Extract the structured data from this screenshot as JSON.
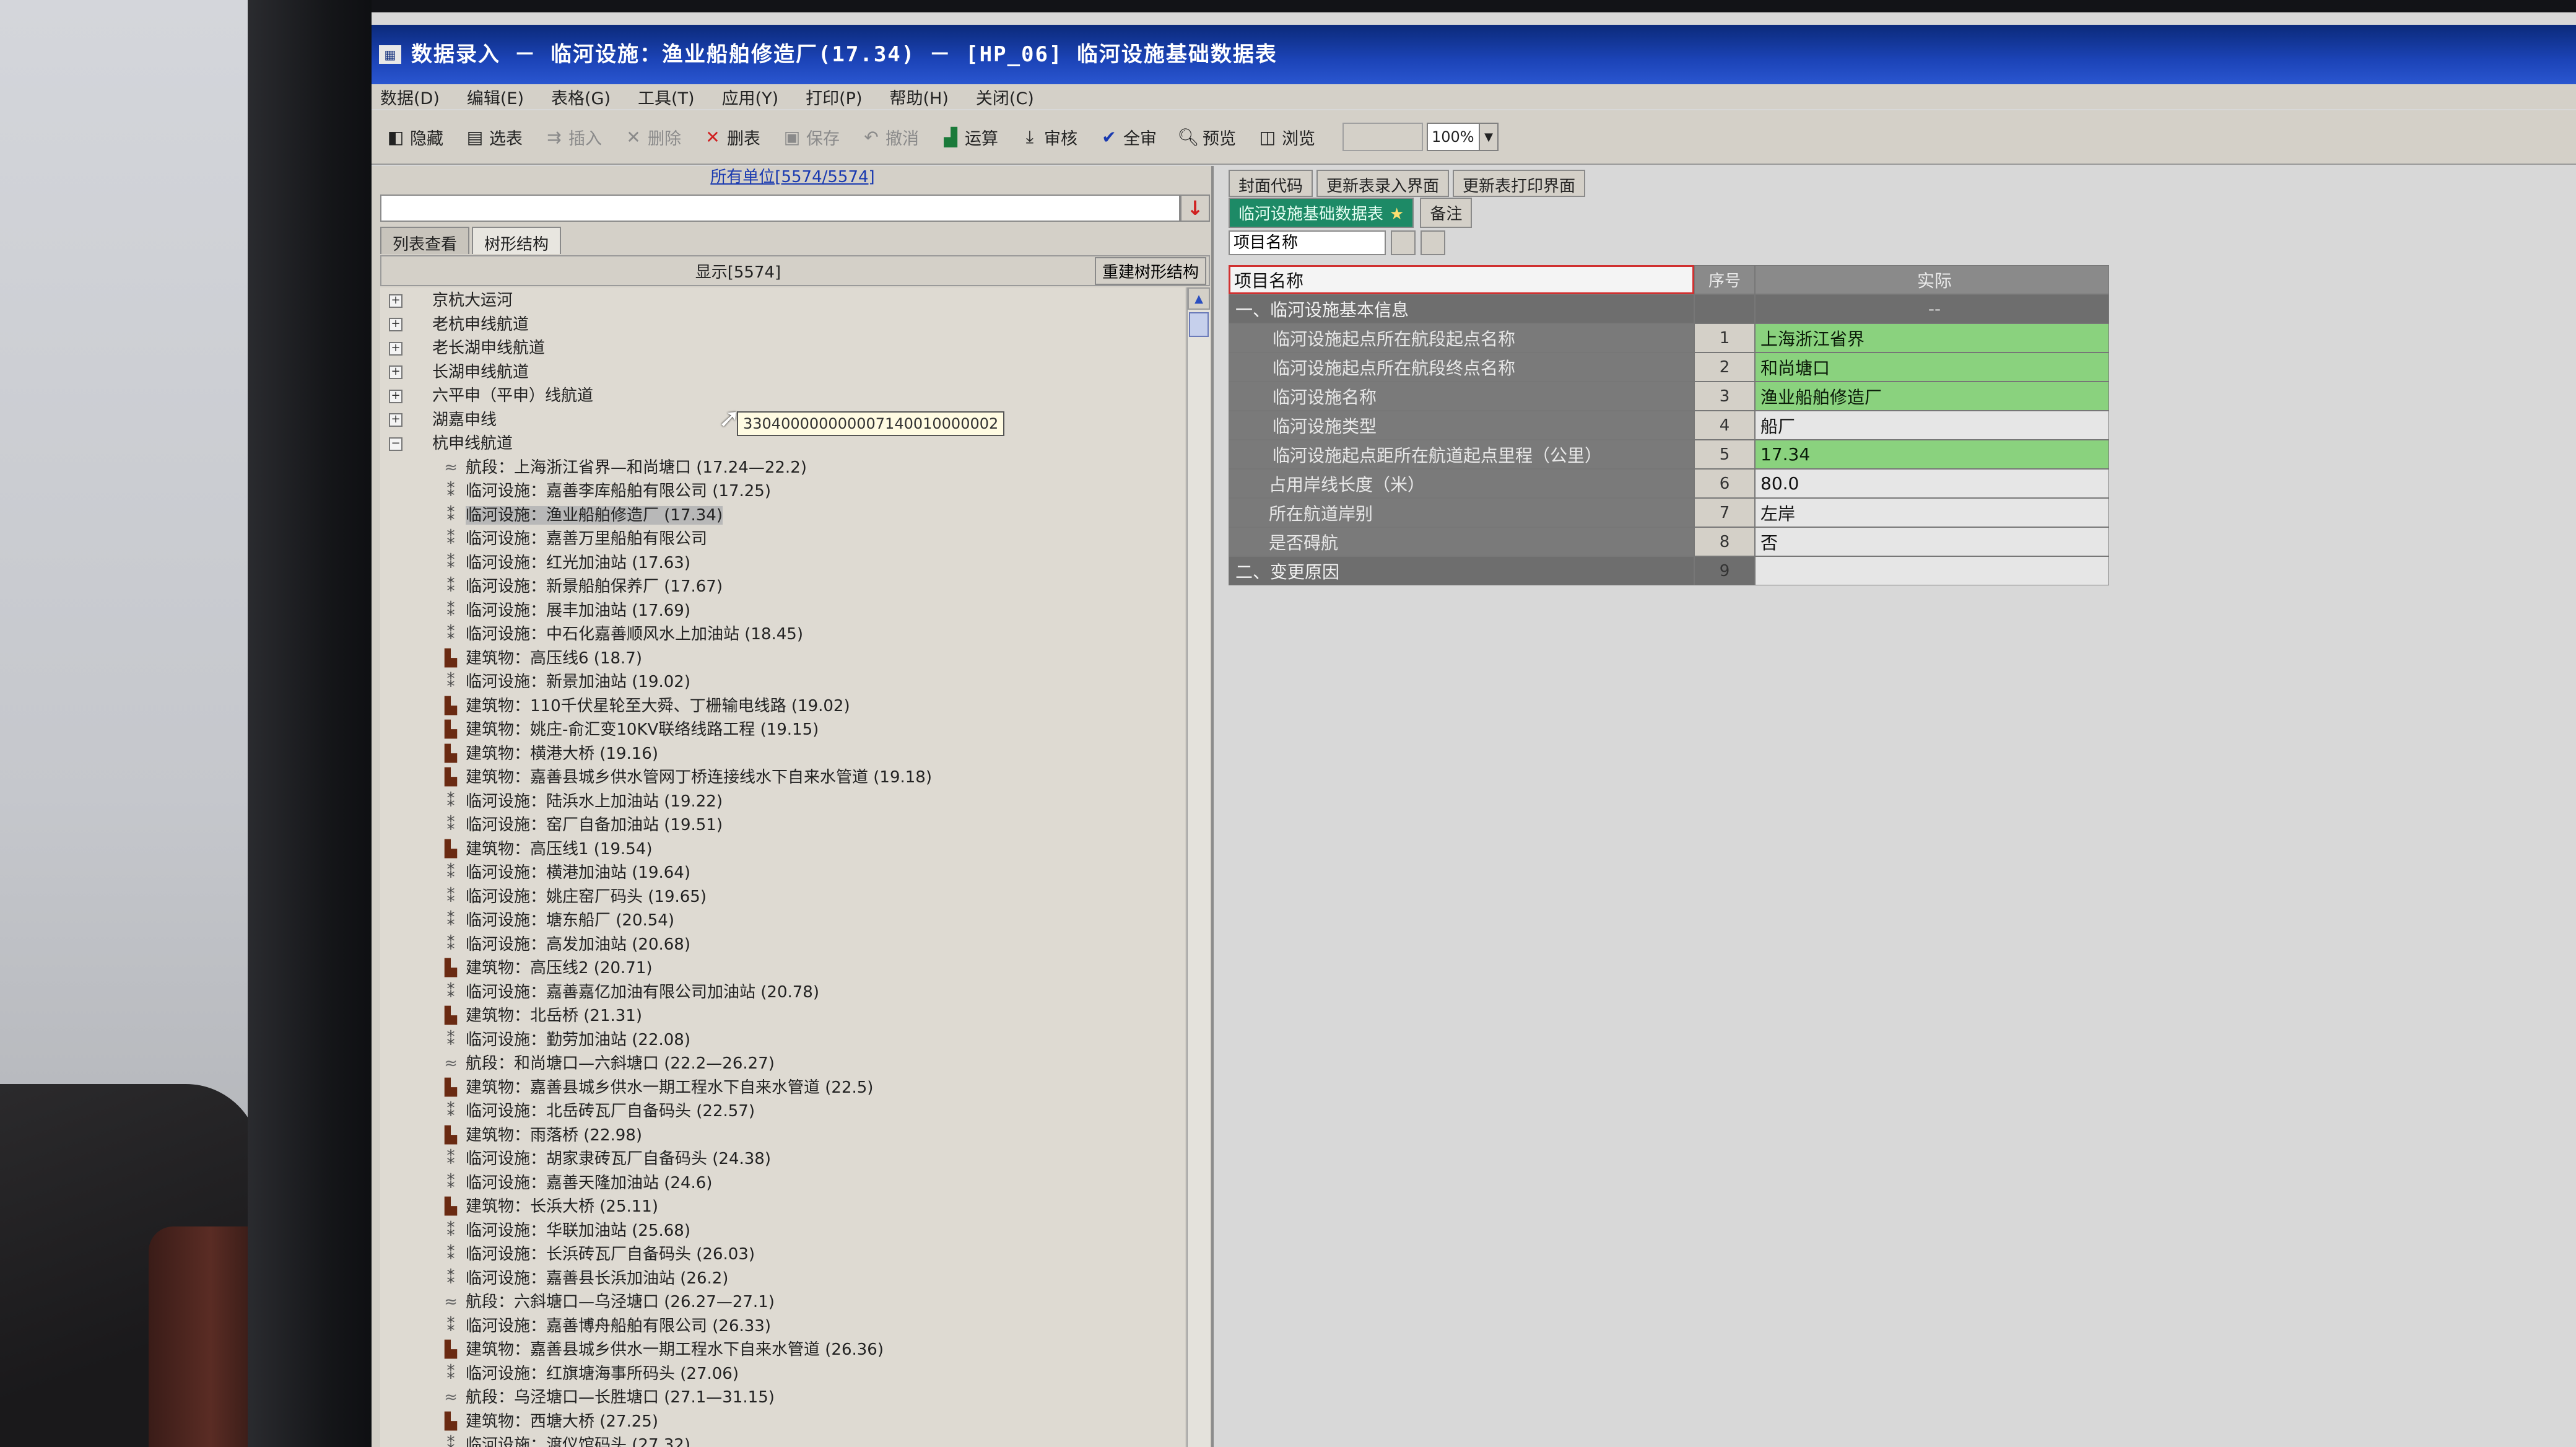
{
  "window": {
    "title": "数据录入 － 临河设施：渔业船舶修造厂(17.34) － [HP_06] 临河设施基础数据表"
  },
  "menu": [
    "数据(D)",
    "编辑(E)",
    "表格(G)",
    "工具(T)",
    "应用(Y)",
    "打印(P)",
    "帮助(H)",
    "关闭(C)"
  ],
  "toolbar": {
    "hide": "隐藏",
    "select_table": "选表",
    "insert": "插入",
    "delete": "删除",
    "delete_table": "删表",
    "save": "保存",
    "undo": "撤消",
    "calculate": "运算",
    "review": "审核",
    "full_review": "全审",
    "preview": "预览",
    "browse": "浏览",
    "zoom": "100%"
  },
  "left_panel": {
    "unit_link": "所有单位[5574/5574]",
    "search_value": "",
    "tabs": [
      "列表查看",
      "树形结构"
    ],
    "display_count": "显示[5574]",
    "rebuild_button": "重建树形结构",
    "tooltip": "330400000000007140010000002"
  },
  "tree": [
    {
      "label": "京杭大运河",
      "kind": "root",
      "exp": "⊞"
    },
    {
      "label": "老杭申线航道",
      "kind": "root",
      "exp": "⊞"
    },
    {
      "label": "老长湖申线航道",
      "kind": "root",
      "exp": "⊞"
    },
    {
      "label": "长湖申线航道",
      "kind": "root",
      "exp": "⊞"
    },
    {
      "label": "六平申（平申）线航道",
      "kind": "root",
      "exp": "⊞"
    },
    {
      "label": "湖嘉申线",
      "kind": "root",
      "exp": "⊞"
    },
    {
      "label": "杭申线航道",
      "kind": "root",
      "exp": "⊟"
    },
    {
      "label": "航段：上海浙江省界—和尚塘口 (17.24—22.2)",
      "kind": "seg"
    },
    {
      "label": "临河设施：嘉善李库船舶有限公司 (17.25)",
      "kind": "fac"
    },
    {
      "label": "临河设施：渔业船舶修造厂 (17.34)",
      "kind": "fac",
      "selected": true
    },
    {
      "label": "临河设施：嘉善万里船舶有限公司",
      "kind": "fac"
    },
    {
      "label": "临河设施：红光加油站 (17.63)",
      "kind": "fac"
    },
    {
      "label": "临河设施：新景船舶保养厂 (17.67)",
      "kind": "fac"
    },
    {
      "label": "临河设施：展丰加油站 (17.69)",
      "kind": "fac"
    },
    {
      "label": "临河设施：中石化嘉善顺风水上加油站 (18.45)",
      "kind": "fac"
    },
    {
      "label": "建筑物：高压线6 (18.7)",
      "kind": "bld"
    },
    {
      "label": "临河设施：新景加油站 (19.02)",
      "kind": "fac"
    },
    {
      "label": "建筑物：110千伏星轮至大舜、丁栅输电线路 (19.02)",
      "kind": "bld"
    },
    {
      "label": "建筑物：姚庄-俞汇变10KV联络线路工程 (19.15)",
      "kind": "bld"
    },
    {
      "label": "建筑物：横港大桥 (19.16)",
      "kind": "bld"
    },
    {
      "label": "建筑物：嘉善县城乡供水管网丁桥连接线水下自来水管道 (19.18)",
      "kind": "bld"
    },
    {
      "label": "临河设施：陆浜水上加油站 (19.22)",
      "kind": "fac"
    },
    {
      "label": "临河设施：窑厂自备加油站 (19.51)",
      "kind": "fac"
    },
    {
      "label": "建筑物：高压线1 (19.54)",
      "kind": "bld"
    },
    {
      "label": "临河设施：横港加油站 (19.64)",
      "kind": "fac"
    },
    {
      "label": "临河设施：姚庄窑厂码头 (19.65)",
      "kind": "fac"
    },
    {
      "label": "临河设施：塘东船厂 (20.54)",
      "kind": "fac"
    },
    {
      "label": "临河设施：高发加油站 (20.68)",
      "kind": "fac"
    },
    {
      "label": "建筑物：高压线2 (20.71)",
      "kind": "bld"
    },
    {
      "label": "临河设施：嘉善嘉亿加油有限公司加油站 (20.78)",
      "kind": "fac"
    },
    {
      "label": "建筑物：北岳桥 (21.31)",
      "kind": "bld"
    },
    {
      "label": "临河设施：勤劳加油站 (22.08)",
      "kind": "fac"
    },
    {
      "label": "航段：和尚塘口—六斜塘口 (22.2—26.27)",
      "kind": "seg"
    },
    {
      "label": "建筑物：嘉善县城乡供水一期工程水下自来水管道 (22.5)",
      "kind": "bld"
    },
    {
      "label": "临河设施：北岳砖瓦厂自备码头 (22.57)",
      "kind": "fac"
    },
    {
      "label": "建筑物：雨落桥 (22.98)",
      "kind": "bld"
    },
    {
      "label": "临河设施：胡家隶砖瓦厂自备码头 (24.38)",
      "kind": "fac"
    },
    {
      "label": "临河设施：嘉善天隆加油站 (24.6)",
      "kind": "fac"
    },
    {
      "label": "建筑物：长浜大桥 (25.11)",
      "kind": "bld"
    },
    {
      "label": "临河设施：华联加油站 (25.68)",
      "kind": "fac"
    },
    {
      "label": "临河设施：长浜砖瓦厂自备码头 (26.03)",
      "kind": "fac"
    },
    {
      "label": "临河设施：嘉善县长浜加油站 (26.2)",
      "kind": "fac"
    },
    {
      "label": "航段：六斜塘口—乌泾塘口 (26.27—27.1)",
      "kind": "seg"
    },
    {
      "label": "临河设施：嘉善博舟船舶有限公司 (26.33)",
      "kind": "fac"
    },
    {
      "label": "建筑物：嘉善县城乡供水一期工程水下自来水管道 (26.36)",
      "kind": "bld"
    },
    {
      "label": "临河设施：红旗塘海事所码头 (27.06)",
      "kind": "fac"
    },
    {
      "label": "航段：乌泾塘口—长胜塘口 (27.1—31.15)",
      "kind": "seg"
    },
    {
      "label": "建筑物：西塘大桥 (27.25)",
      "kind": "bld"
    },
    {
      "label": "临河设施：渡仪馆码头 (27.32)",
      "kind": "fac"
    }
  ],
  "right_panel": {
    "tabs_top": [
      "封面代码",
      "更新表录入界面",
      "更新表打印界面"
    ],
    "tabs_second": [
      "临河设施基础数据表",
      "备注"
    ],
    "field_name": "项目名称",
    "grid_header": {
      "name": "项目名称",
      "seq": "序号",
      "value": "实际"
    },
    "grid_rows": [
      {
        "name": "一、临河设施基本信息",
        "seq": "",
        "value": "--",
        "style": "sec"
      },
      {
        "name": "临河设施起点所在航段起点名称",
        "seq": "1",
        "value": "上海浙江省界",
        "style": "green"
      },
      {
        "name": "临河设施起点所在航段终点名称",
        "seq": "2",
        "value": "和尚塘口",
        "style": "green"
      },
      {
        "name": "临河设施名称",
        "seq": "3",
        "value": "渔业船舶修造厂",
        "style": "green"
      },
      {
        "name": "临河设施类型",
        "seq": "4",
        "value": "船厂",
        "style": ""
      },
      {
        "name": "临河设施起点距所在航道起点里程（公里）",
        "seq": "5",
        "value": "17.34",
        "style": "green"
      },
      {
        "name": "占用岸线长度（米）",
        "seq": "6",
        "value": "80.0",
        "style": "sub2"
      },
      {
        "name": "所在航道岸别",
        "seq": "7",
        "value": "左岸",
        "style": "sub2"
      },
      {
        "name": "是否碍航",
        "seq": "8",
        "value": "否",
        "style": "sub2"
      },
      {
        "name": "二、变更原因",
        "seq": "9",
        "value": "",
        "style": "sec2"
      }
    ]
  }
}
